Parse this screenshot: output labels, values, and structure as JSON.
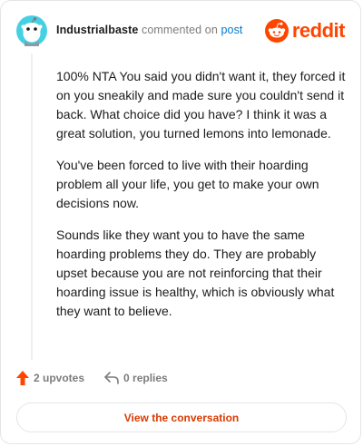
{
  "header": {
    "username": "Industrialbaste",
    "commented_on": "commented on",
    "post_link": "post"
  },
  "brand": {
    "wordmark": "reddit",
    "color": "#ff4500"
  },
  "comment": {
    "paragraphs": [
      "100% NTA You said you didn't want it, they forced it on you sneakily and made sure you couldn't send it back. What choice did you have? I think it was a great solution, you turned lemons into lemonade.",
      "You've been forced to live with their hoarding problem all your life, you get to make your own decisions now.",
      "Sounds like they want you to have the same hoarding problems they do. They are probably upset because you are not reinforcing that their hoarding issue is healthy, which is obviously what they want to believe."
    ]
  },
  "footer": {
    "upvotes": "2 upvotes",
    "replies": "0 replies",
    "upvote_icon": "upvote-arrow-icon",
    "reply_icon": "reply-arrow-icon"
  },
  "cta": {
    "label": "View the conversation"
  }
}
